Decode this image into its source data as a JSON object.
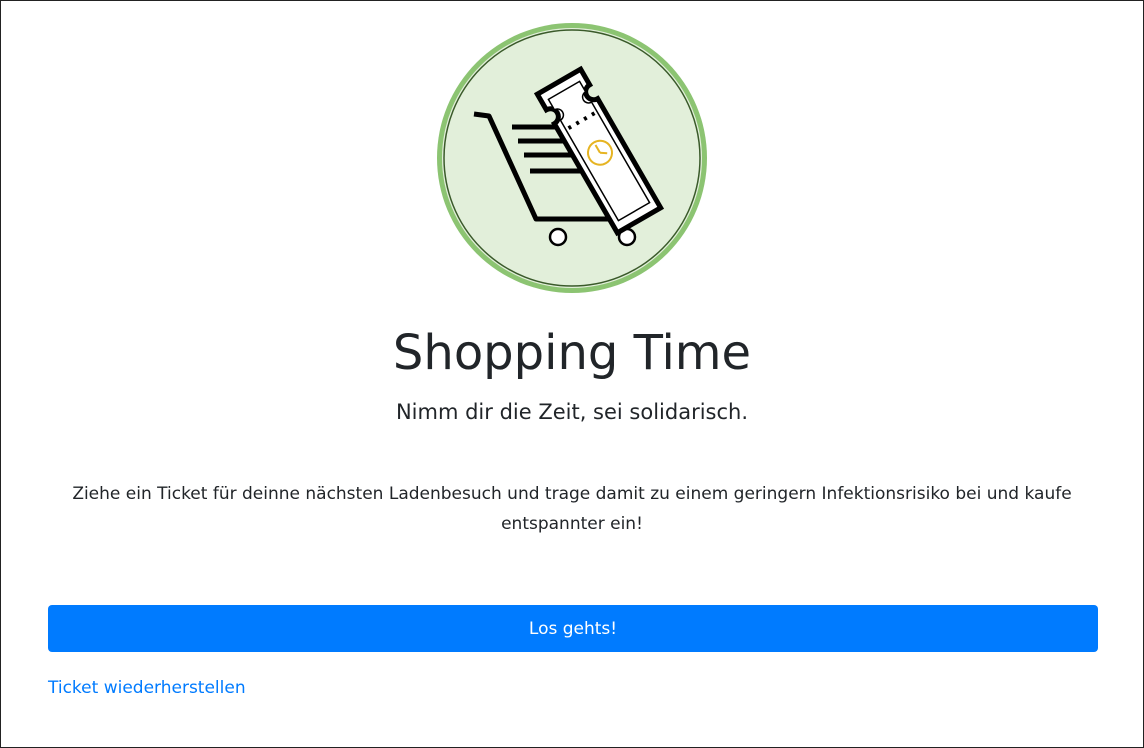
{
  "logo": {
    "icon": "shopping-cart-ticket-icon",
    "circle_fill": "#e2efda",
    "circle_stroke": "#8cc472",
    "clock_color": "#e6b422"
  },
  "heading": {
    "title": "Shopping Time",
    "subtitle": "Nimm dir die Zeit, sei solidarisch."
  },
  "description": "Ziehe ein Ticket für deinne nächsten Ladenbesuch und trage damit zu einem geringern Infektionsrisiko bei und kaufe entspannter ein!",
  "actions": {
    "start_label": "Los gehts!",
    "restore_label": "Ticket wiederherstellen"
  },
  "colors": {
    "accent": "#007bff",
    "text": "#212529"
  }
}
